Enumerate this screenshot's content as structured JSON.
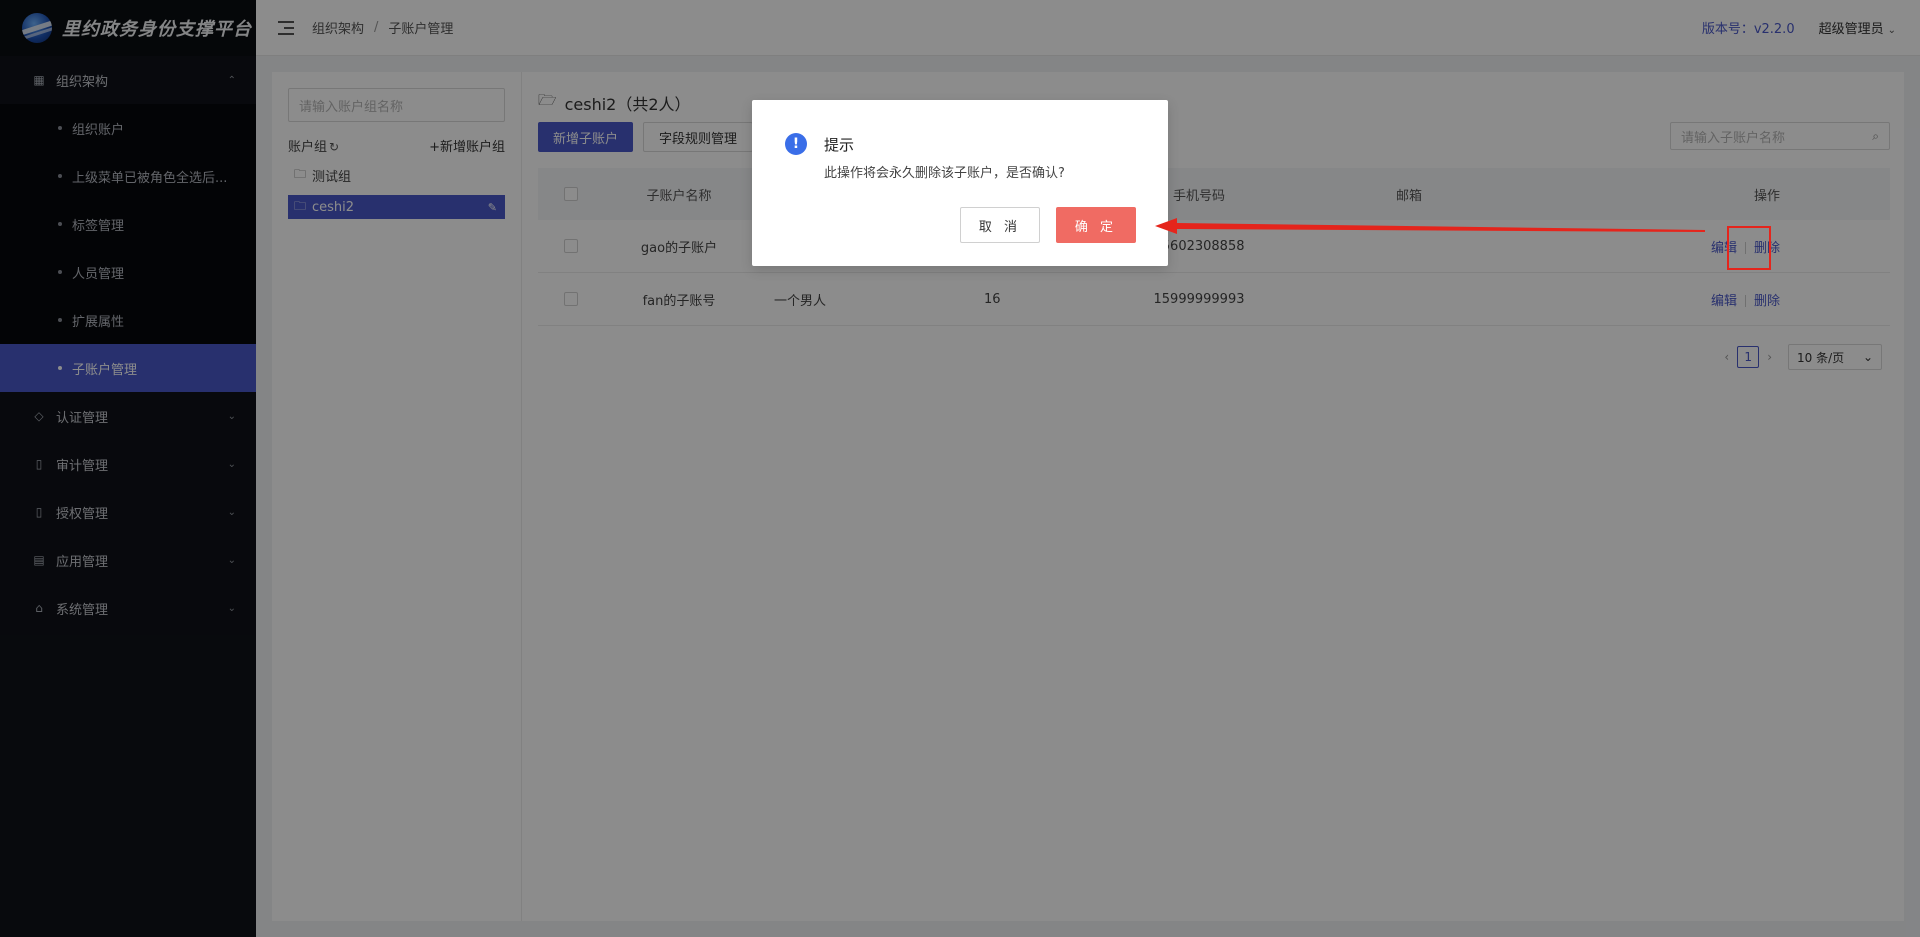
{
  "app": {
    "title": "里约政务身份支撑平台"
  },
  "sidebar": {
    "groups": [
      {
        "label": "组织架构",
        "icon": "org-icon",
        "expanded": true,
        "items": [
          "组织账户",
          "上级菜单已被角色全选后...",
          "标签管理",
          "人员管理",
          "扩展属性",
          "子账户管理"
        ],
        "active_item": "子账户管理"
      },
      {
        "label": "认证管理",
        "icon": "tag-icon"
      },
      {
        "label": "审计管理",
        "icon": "doc-icon"
      },
      {
        "label": "授权管理",
        "icon": "doc-icon"
      },
      {
        "label": "应用管理",
        "icon": "app-icon"
      },
      {
        "label": "系统管理",
        "icon": "home-icon"
      }
    ]
  },
  "header": {
    "breadcrumb": [
      "组织架构",
      "子账户管理"
    ],
    "version": "版本号：v2.2.0",
    "user": "超级管理员"
  },
  "left_panel": {
    "search_placeholder": "请输入账户组名称",
    "group_label": "账户组",
    "add_label": "+新增账户组",
    "groups": [
      "测试组",
      "ceshi2"
    ],
    "selected_group": "ceshi2"
  },
  "right_panel": {
    "title": "ceshi2（共2人）",
    "add_button": "新增子账户",
    "rule_button": "字段规则管理",
    "search_placeholder": "请输入子账户名称",
    "columns": [
      "子账户名称",
      "",
      "",
      "手机号码",
      "邮箱",
      "操作"
    ],
    "rows": [
      {
        "name": "gao的子账户",
        "nick": "",
        "age": "",
        "phone": "15602308858",
        "email": ""
      },
      {
        "name": "fan的子账号",
        "nick": "一个男人",
        "age": "16",
        "phone": "15999999993",
        "email": ""
      }
    ],
    "edit_label": "编辑",
    "delete_label": "删除",
    "pagination": {
      "current_page": "1",
      "page_size": "10 条/页"
    }
  },
  "modal": {
    "title": "提示",
    "message": "此操作将会永久删除该子账户，是否确认?",
    "cancel": "取 消",
    "confirm": "确 定"
  },
  "colors": {
    "primary": "#4a58c8",
    "danger_button": "#f06b63",
    "annotation": "#e5251c",
    "sidebar_bg": "#0f1218"
  }
}
